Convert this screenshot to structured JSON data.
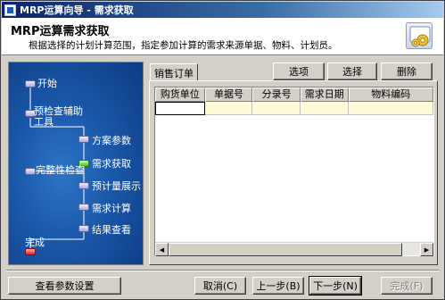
{
  "window": {
    "title": "MRP运算向导 - 需求获取"
  },
  "header": {
    "title": "MRP运算需求获取",
    "description": "根据选择的计划计算范围，指定参加计算的需求来源单据、物料、计划员。",
    "icon": "gear-icon"
  },
  "flow": {
    "steps": [
      {
        "label": "开始",
        "state": "done"
      },
      {
        "label": "预检查辅助",
        "label2": "工具",
        "state": "done"
      },
      {
        "label": "方案参数",
        "state": "done"
      },
      {
        "label": "需求获取",
        "state": "current"
      },
      {
        "label": "完整性检查",
        "state": "pending"
      },
      {
        "label": "预计量展示",
        "state": "pending"
      },
      {
        "label": "需求计算",
        "state": "pending"
      },
      {
        "label": "结果查看",
        "state": "pending"
      },
      {
        "label": "完成",
        "state": "end"
      }
    ]
  },
  "tabs": [
    {
      "label": "销售订单",
      "selected": true
    }
  ],
  "toolbar": {
    "options_label": "选项",
    "select_label": "选择",
    "delete_label": "删除"
  },
  "grid": {
    "columns": [
      "购货单位",
      "单据号",
      "分录号",
      "需求日期",
      "物料编码"
    ],
    "rows": [
      [
        "",
        "",
        "",
        "",
        ""
      ]
    ]
  },
  "footer": {
    "view_params_label": "查看参数设置",
    "cancel_label": "取消(C)",
    "back_label": "上一步(B)",
    "next_label": "下一步(N)",
    "finish_label": "完成(F)"
  }
}
